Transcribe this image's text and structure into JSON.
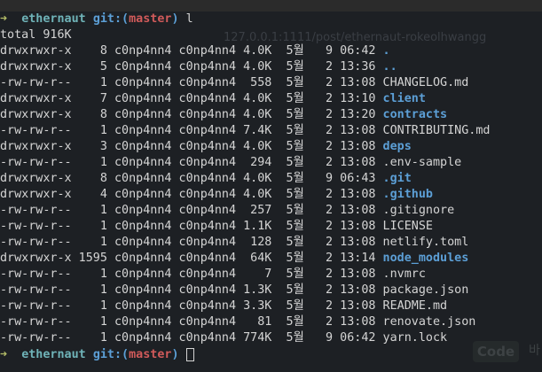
{
  "prompt": {
    "arrow": "➜",
    "repo": "ethernaut",
    "git_open": "git:(",
    "branch": "master",
    "git_close": ")",
    "command": "l"
  },
  "total": "total 916K",
  "files": [
    [
      "drwxrwxr-x",
      "8",
      "c0np4nn4",
      "c0np4nn4",
      "4.0K",
      "5월",
      "9",
      "06:42",
      ".",
      true
    ],
    [
      "drwxrwxr-x",
      "5",
      "c0np4nn4",
      "c0np4nn4",
      "4.0K",
      "5월",
      "2",
      "13:36",
      "..",
      true
    ],
    [
      "-rw-rw-r--",
      "1",
      "c0np4nn4",
      "c0np4nn4",
      "558",
      "5월",
      "2",
      "13:08",
      "CHANGELOG.md",
      false
    ],
    [
      "drwxrwxr-x",
      "7",
      "c0np4nn4",
      "c0np4nn4",
      "4.0K",
      "5월",
      "2",
      "13:10",
      "client",
      true
    ],
    [
      "drwxrwxr-x",
      "8",
      "c0np4nn4",
      "c0np4nn4",
      "4.0K",
      "5월",
      "2",
      "13:20",
      "contracts",
      true
    ],
    [
      "-rw-rw-r--",
      "1",
      "c0np4nn4",
      "c0np4nn4",
      "7.4K",
      "5월",
      "2",
      "13:08",
      "CONTRIBUTING.md",
      false
    ],
    [
      "drwxrwxr-x",
      "3",
      "c0np4nn4",
      "c0np4nn4",
      "4.0K",
      "5월",
      "2",
      "13:08",
      "deps",
      true
    ],
    [
      "-rw-rw-r--",
      "1",
      "c0np4nn4",
      "c0np4nn4",
      "294",
      "5월",
      "2",
      "13:08",
      ".env-sample",
      false
    ],
    [
      "drwxrwxr-x",
      "8",
      "c0np4nn4",
      "c0np4nn4",
      "4.0K",
      "5월",
      "9",
      "06:43",
      ".git",
      true
    ],
    [
      "drwxrwxr-x",
      "4",
      "c0np4nn4",
      "c0np4nn4",
      "4.0K",
      "5월",
      "2",
      "13:08",
      ".github",
      true
    ],
    [
      "-rw-rw-r--",
      "1",
      "c0np4nn4",
      "c0np4nn4",
      "257",
      "5월",
      "2",
      "13:08",
      ".gitignore",
      false
    ],
    [
      "-rw-rw-r--",
      "1",
      "c0np4nn4",
      "c0np4nn4",
      "1.1K",
      "5월",
      "2",
      "13:08",
      "LICENSE",
      false
    ],
    [
      "-rw-rw-r--",
      "1",
      "c0np4nn4",
      "c0np4nn4",
      "128",
      "5월",
      "2",
      "13:08",
      "netlify.toml",
      false
    ],
    [
      "drwxrwxr-x",
      "1595",
      "c0np4nn4",
      "c0np4nn4",
      "64K",
      "5월",
      "2",
      "13:14",
      "node_modules",
      true
    ],
    [
      "-rw-rw-r--",
      "1",
      "c0np4nn4",
      "c0np4nn4",
      "7",
      "5월",
      "2",
      "13:08",
      ".nvmrc",
      false
    ],
    [
      "-rw-rw-r--",
      "1",
      "c0np4nn4",
      "c0np4nn4",
      "1.3K",
      "5월",
      "2",
      "13:08",
      "package.json",
      false
    ],
    [
      "-rw-rw-r--",
      "1",
      "c0np4nn4",
      "c0np4nn4",
      "3.3K",
      "5월",
      "2",
      "13:08",
      "README.md",
      false
    ],
    [
      "-rw-rw-r--",
      "1",
      "c0np4nn4",
      "c0np4nn4",
      "81",
      "5월",
      "2",
      "13:08",
      "renovate.json",
      false
    ],
    [
      "-rw-rw-r--",
      "1",
      "c0np4nn4",
      "c0np4nn4",
      "774K",
      "5월",
      "9",
      "06:42",
      "yarn.lock",
      false
    ]
  ],
  "ghost": {
    "url": "127.0.0.1:1111/post/ethernaut-rokeolhwangg",
    "code": "Code",
    "ba": "바"
  }
}
